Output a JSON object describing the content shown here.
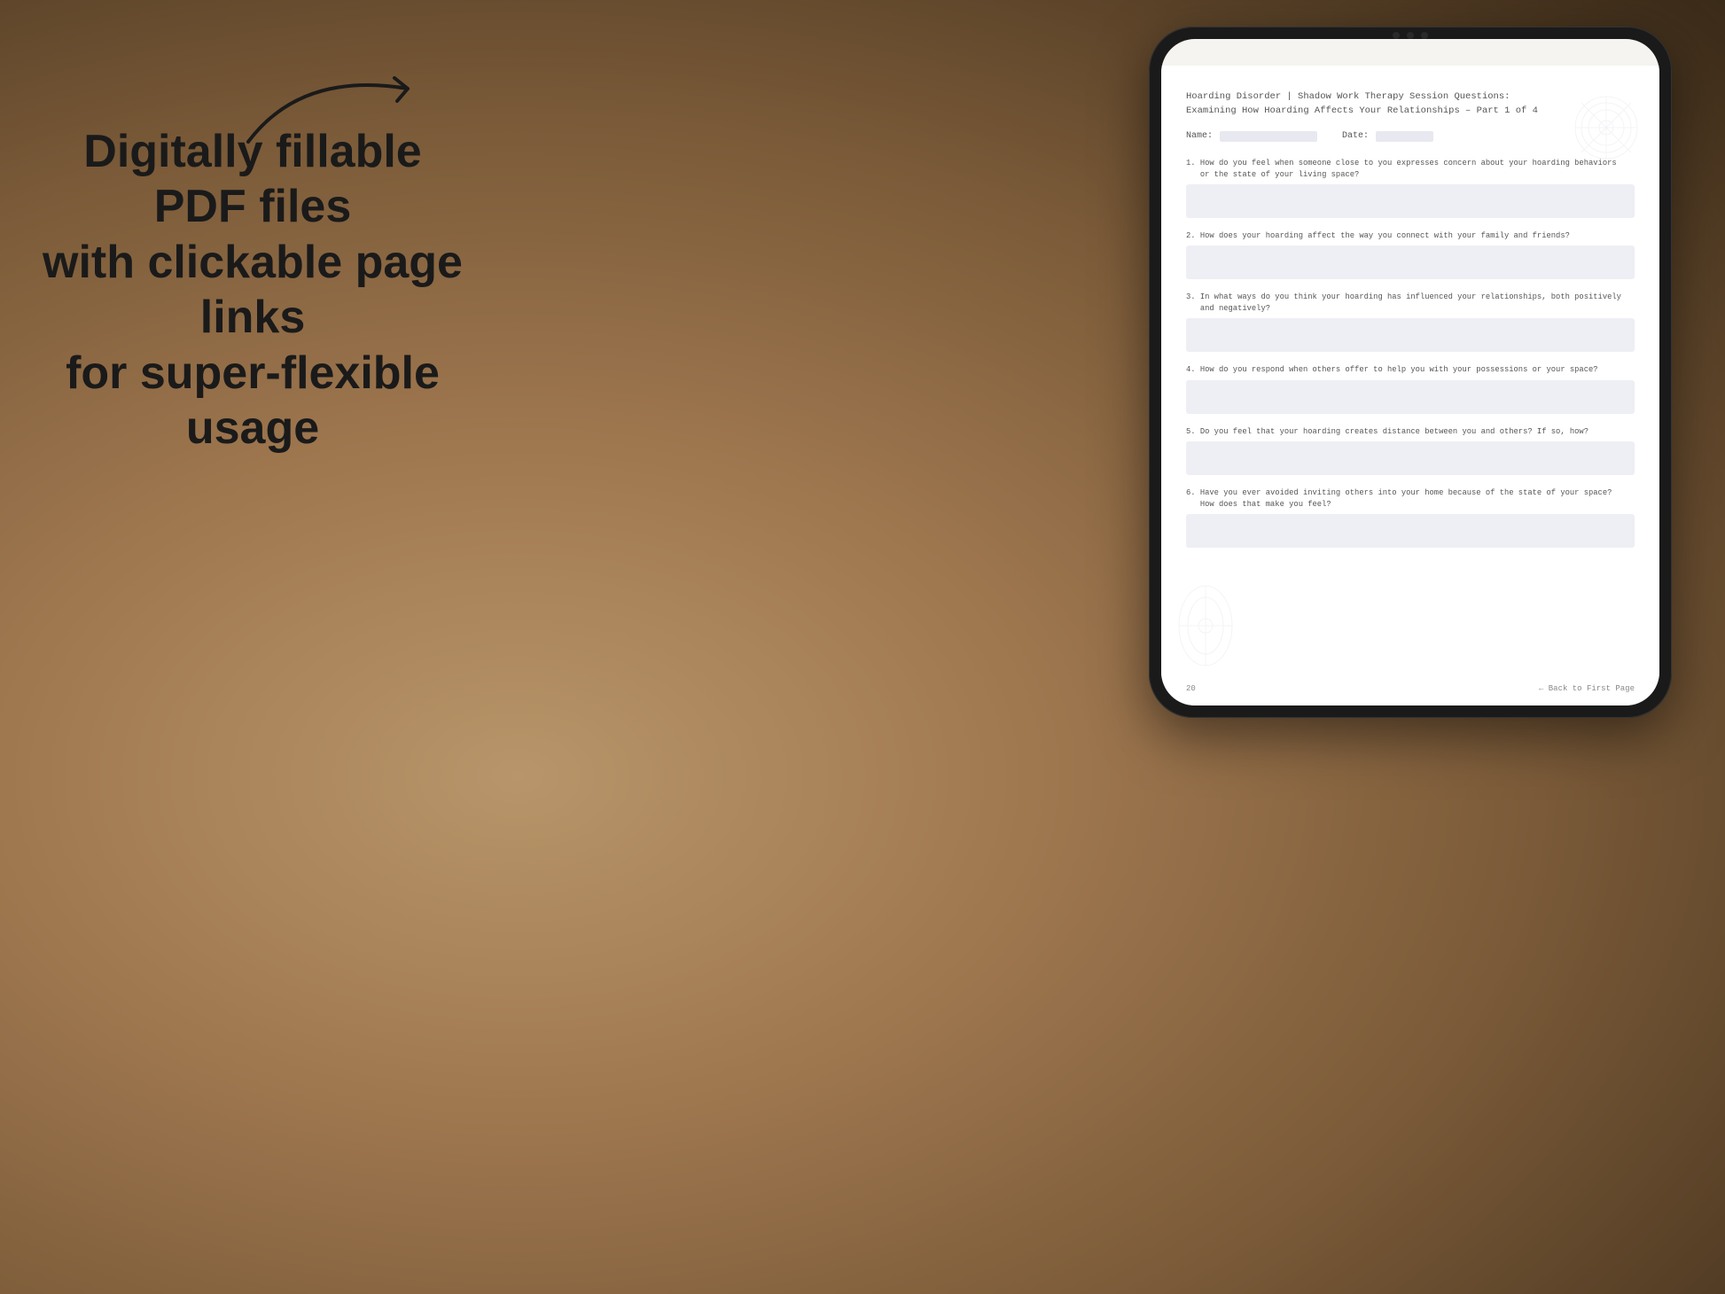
{
  "background": {
    "color_main": "#c4a882",
    "color_dark": "#7a5a38"
  },
  "left_panel": {
    "tagline_line1": "Digitally fillable PDF files",
    "tagline_line2": "with clickable page links",
    "tagline_line3": "for super-flexible usage"
  },
  "arrow": {
    "label": "arrow pointing to tablet"
  },
  "tablet": {
    "pdf": {
      "title_line1": "Hoarding Disorder | Shadow Work Therapy Session Questions:",
      "title_line2": "Examining How Hoarding Affects Your Relationships  – Part 1 of 4",
      "name_label": "Name:",
      "date_label": "Date:",
      "questions": [
        {
          "number": "1.",
          "text": "How do you feel when someone close to you expresses concern about your hoarding behaviors\n   or the state of your living space?"
        },
        {
          "number": "2.",
          "text": "How does your hoarding affect the way you connect with your family and friends?"
        },
        {
          "number": "3.",
          "text": "In what ways do you think your hoarding has influenced your relationships, both positively\n   and negatively?"
        },
        {
          "number": "4.",
          "text": "How do you respond when others offer to help you with your possessions or your space?"
        },
        {
          "number": "5.",
          "text": "Do you feel that your hoarding creates distance between you and others? If so, how?"
        },
        {
          "number": "6.",
          "text": "Have you ever avoided inviting others into your home because of the state of your space?\n   How does that make you feel?"
        }
      ],
      "footer": {
        "page_number": "20",
        "back_link": "← Back to First Page"
      }
    }
  }
}
